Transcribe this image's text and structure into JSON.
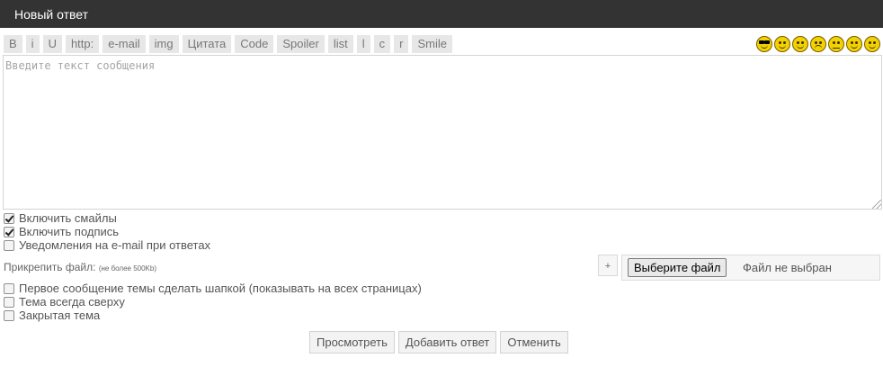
{
  "header": {
    "title": "Новый ответ"
  },
  "toolbar": {
    "buttons": [
      "B",
      "i",
      "U",
      "http:",
      "e-mail",
      "img",
      "Цитата",
      "Code",
      "Spoiler",
      "list",
      "l",
      "c",
      "r",
      "Smile"
    ]
  },
  "smileys": [
    "cool-smiley-icon",
    "wink-smiley-icon",
    "smile-smiley-icon",
    "sad-smiley-icon",
    "confused-smiley-icon",
    "rolleyes-smiley-icon",
    "happy-smiley-icon"
  ],
  "message": {
    "placeholder": "Введите текст сообщения",
    "value": ""
  },
  "options": [
    {
      "label": "Включить смайлы",
      "checked": true
    },
    {
      "label": "Включить подпись",
      "checked": true
    },
    {
      "label": "Уведомления на e-mail при ответах",
      "checked": false
    }
  ],
  "attach": {
    "label": "Прикрепить файл:",
    "hint": "(не более 500Kb)",
    "add_label": "+",
    "choose_label": "Выберите файл",
    "status": "Файл не выбран"
  },
  "topic_options": [
    {
      "label": "Первое сообщение темы сделать шапкой (показывать на всех страницах)",
      "checked": false
    },
    {
      "label": "Тема всегда сверху",
      "checked": false
    },
    {
      "label": "Закрытая тема",
      "checked": false
    }
  ],
  "actions": {
    "preview": "Просмотреть",
    "submit": "Добавить ответ",
    "cancel": "Отменить"
  },
  "colors": {
    "header_bg": "#333333",
    "toolbar_bg": "#e7e7e7",
    "smiley": "#f2d200"
  }
}
